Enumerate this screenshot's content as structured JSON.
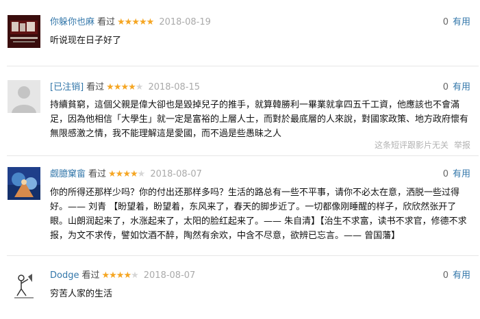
{
  "vote_label": "有用",
  "comments": [
    {
      "author": "你躲你也麻",
      "watched": "看过",
      "rating": 5,
      "date": "2018-08-19",
      "votes": "0",
      "text": "听说现在日子好了"
    },
    {
      "author": "[已注销]",
      "watched": "看过",
      "rating": 4,
      "date": "2018-08-15",
      "votes": "0",
      "text": "持續貧窮，這個父親是偉大卻也是毀掉兒子的推手，就算韓勝利一畢業就拿四五千工資，他應該也不會滿足，因為他相信「大學生」就一定是富裕的上層人士，而對於最底層的人來說，對國家政策、地方政府懷有無限感激之情，我不能理解這是愛國，而不過是些愚昧之人",
      "footer_note": "这条短评跟影片无关",
      "footer_report": "举报"
    },
    {
      "author": "觑臆窠畲",
      "watched": "看过",
      "rating": 4,
      "date": "2018-08-07",
      "votes": "0",
      "text": "你的所得还那样少吗？你的付出还那样多吗？生活的路总有一些不平事，请你不必太在意，洒脱一些过得好。—— 刘青 【盼望着，盼望着，东风来了，春天的脚步近了。一切都像刚睡醒的样子，欣欣然张开了眼。山朗润起来了，水涨起来了，太阳的脸红起来了。—— 朱自清】【治生不求富，读书不求官，修德不求报，为文不求传，譬如饮酒不醉，陶然有余欢，中含不尽意，欲辨已忘言。—— 曾国藩】"
    },
    {
      "author": "Dodge",
      "watched": "看过",
      "rating": 4,
      "date": "2018-08-07",
      "votes": "0",
      "text": "穷苦人家的生活"
    }
  ]
}
